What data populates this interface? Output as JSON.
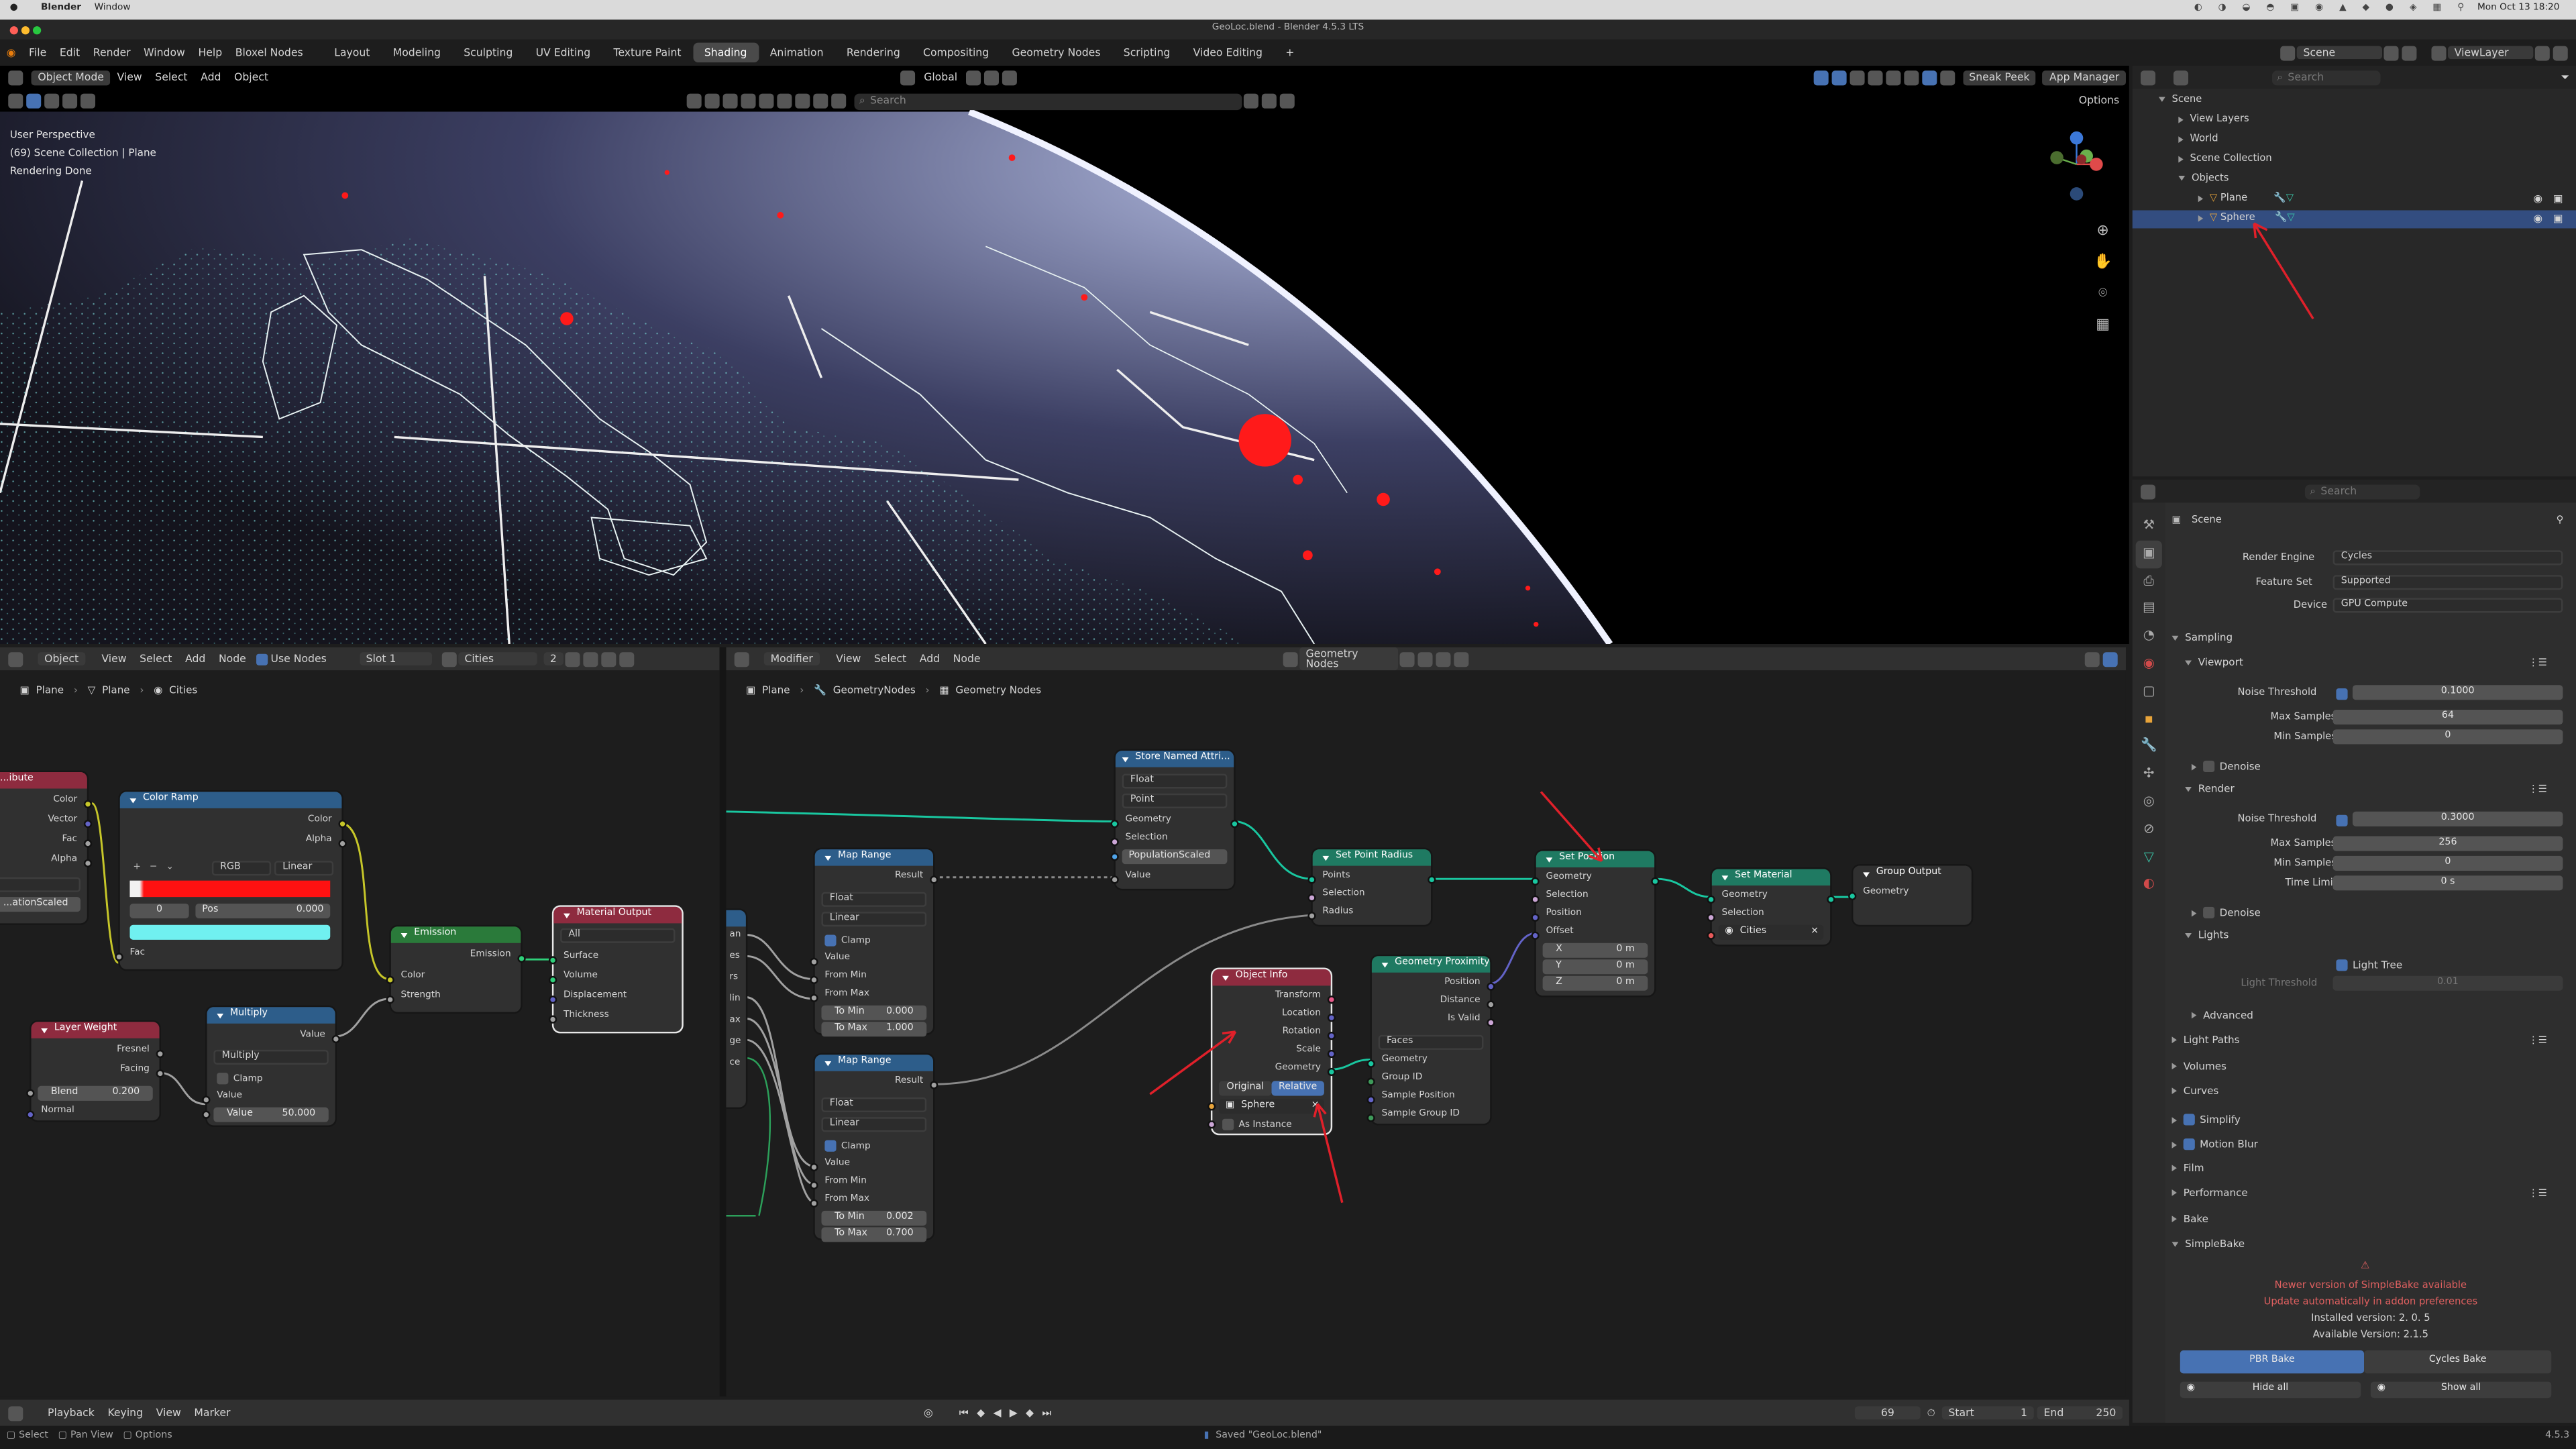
{
  "menubar": {
    "app": "Blender",
    "window": "Window",
    "date": "Mon Oct 13  18:20"
  },
  "title": "GeoLoc.blend - Blender 4.5.3 LTS",
  "topmenu": [
    "File",
    "Edit",
    "Render",
    "Window",
    "Help",
    "Bloxel Nodes"
  ],
  "workspaces": [
    "Layout",
    "Modeling",
    "Sculpting",
    "UV Editing",
    "Texture Paint",
    "Shading",
    "Animation",
    "Rendering",
    "Compositing",
    "Geometry Nodes",
    "Scripting",
    "Video Editing",
    "+"
  ],
  "active_workspace": "Shading",
  "scene": {
    "label": "Scene",
    "view_layer": "ViewLayer"
  },
  "viewport": {
    "mode": "Object Mode",
    "menus": [
      "View",
      "Select",
      "Add",
      "Object"
    ],
    "orientation": "Global",
    "search_placeholder": "Search",
    "sneak_peek": "Sneak Peek",
    "app_manager": "App Manager",
    "options": "Options",
    "info_line1": "User Perspective",
    "info_line2": "(69) Scene Collection | Plane",
    "info_line3": "Rendering Done"
  },
  "outliner": {
    "search_placeholder": "Search",
    "items": [
      "Scene",
      "View Layers",
      "World",
      "Scene Collection",
      "Objects",
      "Plane",
      "Sphere"
    ]
  },
  "properties": {
    "search_placeholder": "Search",
    "scene_label": "Scene",
    "render_engine_label": "Render Engine",
    "render_engine": "Cycles",
    "feature_set_label": "Feature Set",
    "feature_set": "Supported",
    "device_label": "Device",
    "device": "GPU Compute",
    "sampling": "Sampling",
    "viewport": "Viewport",
    "vp_noise_label": "Noise Threshold",
    "vp_noise": "0.1000",
    "vp_max_label": "Max Samples",
    "vp_max": "64",
    "vp_min_label": "Min Samples",
    "vp_min": "0",
    "denoise": "Denoise",
    "render": "Render",
    "r_noise_label": "Noise Threshold",
    "r_noise": "0.3000",
    "r_max_label": "Max Samples",
    "r_max": "256",
    "r_min_label": "Min Samples",
    "r_min": "0",
    "time_limit_label": "Time Limit",
    "time_limit": "0 s",
    "denoise2": "Denoise",
    "lights": "Lights",
    "light_tree": "Light Tree",
    "light_threshold_label": "Light Threshold",
    "light_threshold": "0.01",
    "advanced": "Advanced",
    "light_paths": "Light Paths",
    "volumes": "Volumes",
    "curves": "Curves",
    "simplify": "Simplify",
    "motion_blur": "Motion Blur",
    "film": "Film",
    "performance": "Performance",
    "bake": "Bake",
    "simplebake": "SimpleBake",
    "sb_warn1": "Newer version of SimpleBake available",
    "sb_warn2": "Update automatically in addon preferences",
    "sb_installed": "Installed version: 2. 0. 5",
    "sb_available": "Available Version: 2.1.5",
    "pbr_bake": "PBR Bake",
    "cycles_bake": "Cycles Bake",
    "hide_all": "Hide all",
    "show_all": "Show all"
  },
  "shader_editor": {
    "object": "Object",
    "menus": [
      "View",
      "Select",
      "Add",
      "Node"
    ],
    "use_nodes": "Use Nodes",
    "slot": "Slot 1",
    "material": "Cities",
    "users": "2",
    "breadcrumb": [
      "Plane",
      "Plane",
      "Cities"
    ],
    "nodes": {
      "attr": {
        "title": "...ibute",
        "o": [
          "Color",
          "Vector",
          "Fac",
          "Alpha"
        ],
        "type": "...etry",
        "name": "...ationScaled"
      },
      "ramp": {
        "title": "Color Ramp",
        "outs": [
          "Color",
          "Alpha"
        ],
        "mode": "RGB",
        "interp": "Linear",
        "stop": "0",
        "pos_label": "Pos",
        "pos": "0.000",
        "fac": "Fac"
      },
      "emission": {
        "title": "Emission",
        "out": "Emission",
        "ins": [
          "Color",
          "Strength"
        ]
      },
      "matout": {
        "title": "Material Output",
        "target": "All",
        "ins": [
          "Surface",
          "Volume",
          "Displacement",
          "Thickness"
        ]
      },
      "lw": {
        "title": "Layer Weight",
        "outs": [
          "Fresnel",
          "Facing"
        ],
        "blend_label": "Blend",
        "blend": "0.200",
        "normal": "Normal"
      },
      "mul": {
        "title": "Multiply",
        "out": "Value",
        "op": "Multiply",
        "clamp": "Clamp",
        "in": "Value",
        "val_label": "Value",
        "val": "50.000"
      }
    }
  },
  "geo_editor": {
    "modifier": "Modifier",
    "menus": [
      "View",
      "Select",
      "Add",
      "Node"
    ],
    "tree": "Geometry Nodes",
    "breadcrumb": [
      "Plane",
      "GeometryNodes",
      "Geometry Nodes"
    ],
    "nodes": {
      "sna": {
        "title": "Store Named Attri...",
        "type": "Float",
        "domain": "Point",
        "ins": [
          "Geometry",
          "Selection"
        ],
        "name": "PopulationScaled",
        "value": "Value"
      },
      "mr1": {
        "title": "Map Range",
        "out": "Result",
        "type": "Float",
        "interp": "Linear",
        "clamp": "Clamp",
        "ins": [
          "Value",
          "From Min",
          "From Max"
        ],
        "tomin_label": "To Min",
        "tomin": "0.000",
        "tomax_label": "To Max",
        "tomax": "1.000"
      },
      "mr2": {
        "title": "Map Range",
        "out": "Result",
        "type": "Float",
        "interp": "Linear",
        "clamp": "Clamp",
        "ins": [
          "Value",
          "From Min",
          "From Max"
        ],
        "tomin_label": "To Min",
        "tomin": "0.002",
        "tomax_label": "To Max",
        "tomax": "0.700"
      },
      "spr": {
        "title": "Set Point Radius",
        "out": "Points",
        "ins": [
          "Points",
          "Selection",
          "Radius"
        ]
      },
      "oi": {
        "title": "Object Info",
        "outs": [
          "Transform",
          "Location",
          "Rotation",
          "Scale",
          "Geometry"
        ],
        "original": "Original",
        "relative": "Relative",
        "object": "Sphere",
        "as_instance": "As Instance"
      },
      "gp": {
        "title": "Geometry Proximity",
        "outs": [
          "Position",
          "Distance",
          "Is Valid"
        ],
        "mode": "Faces",
        "ins": [
          "Geometry",
          "Group ID",
          "Sample Position",
          "Sample Group ID"
        ]
      },
      "sp": {
        "title": "Set Position",
        "out": "Geometry",
        "ins": [
          "Geometry",
          "Selection",
          "Position",
          "Offset"
        ],
        "x_label": "X",
        "x": "0 m",
        "y_label": "Y",
        "y": "0 m",
        "z_label": "Z",
        "z": "0 m"
      },
      "sm": {
        "title": "Set Material",
        "out": "Geometry",
        "ins": [
          "Geometry",
          "Selection"
        ],
        "material": "Cities"
      },
      "go": {
        "title": "Group Output",
        "in": "Geometry"
      },
      "frag": [
        "an",
        "es",
        "rs",
        "lin",
        "ax",
        "ge",
        "ce"
      ]
    }
  },
  "timeline": {
    "menus": [
      "Playback",
      "Keying",
      "View",
      "Marker"
    ],
    "frame": "69",
    "start_label": "Start",
    "start": "1",
    "end_label": "End",
    "end": "250"
  },
  "status": {
    "select": "Select",
    "pan": "Pan View",
    "options": "Options",
    "message": "Saved \"GeoLoc.blend\"",
    "version": "4.5.3"
  },
  "colors": {
    "accent": "#4772b3",
    "annotation": "#e0202a",
    "input": "#8e2b3f",
    "shader": "#2a7a3a",
    "converter": "#2d5d8a",
    "geometry": "#1f7a62",
    "output": "#8e2b3f"
  }
}
